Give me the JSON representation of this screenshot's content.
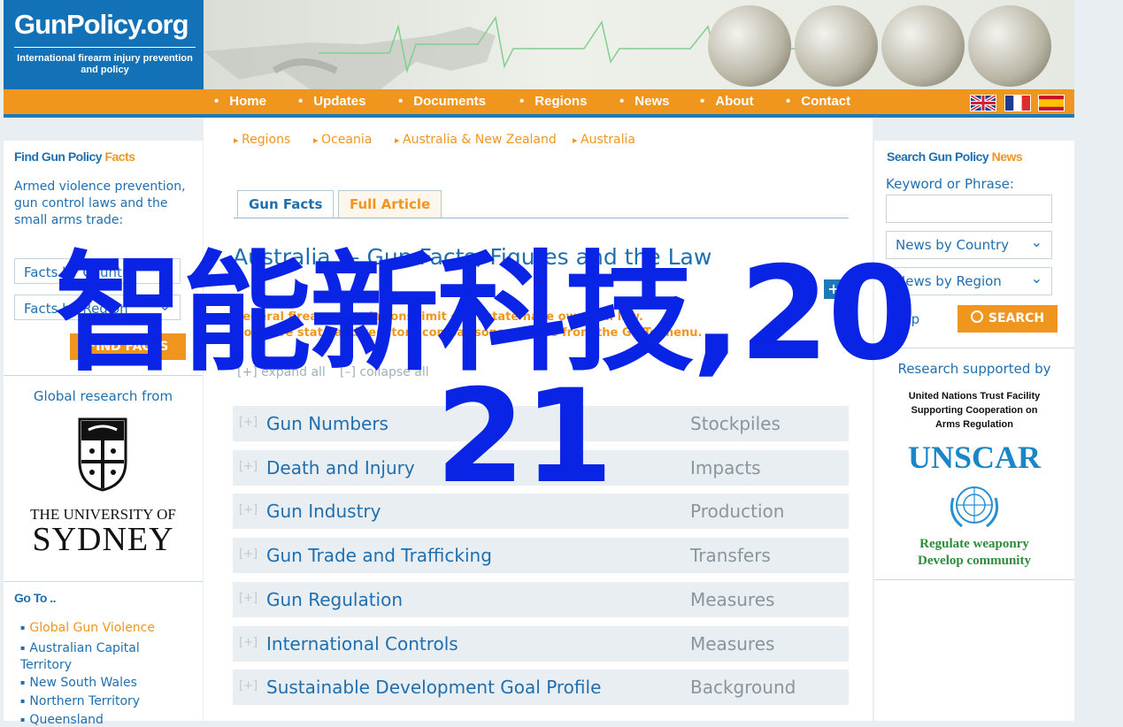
{
  "header": {
    "logo": "GunPolicy.org",
    "tagline": "International firearm injury prevention and policy"
  },
  "nav": {
    "items": [
      "Home",
      "Updates",
      "Documents",
      "Regions",
      "News",
      "About",
      "Contact"
    ]
  },
  "left": {
    "find_title_a": "Find Gun Policy ",
    "find_title_b": "Facts",
    "find_desc": "Armed violence prevention, gun control laws and the small arms trade:",
    "facts_select": "Facts by Country",
    "facts_region": "Facts by Region",
    "find_button": "FIND FACTS",
    "global_research": "Global research from",
    "univ_line1": "THE UNIVERSITY OF",
    "univ_line2": "SYDNEY",
    "goto_title": "Go To ..",
    "goto_items": [
      "Global Gun Violence",
      "Australian Capital Territory",
      "New South Wales",
      "Northern Territory",
      "Queensland"
    ]
  },
  "breadcrumb": [
    "Regions",
    "Oceania",
    "Australia & New Zealand",
    "Australia"
  ],
  "tabs": {
    "gun_facts": "Gun Facts",
    "full_article": "Full Article"
  },
  "main": {
    "title": "Australia — Gun Facts, Figures and the Law",
    "intro": "Federal firearm regulations limit each state have own gun law. Compare state and territory comparisons. choose from the Go To menu.",
    "expand": "expand all",
    "collapse": "collapse all",
    "expand_symbol": "[+]",
    "collapse_symbol": "[–]",
    "rows": [
      {
        "name": "Gun Numbers",
        "cat": "Stockpiles"
      },
      {
        "name": "Death and Injury",
        "cat": "Impacts"
      },
      {
        "name": "Gun Industry",
        "cat": "Production"
      },
      {
        "name": "Gun Trade and Trafficking",
        "cat": "Transfers"
      },
      {
        "name": "Gun Regulation",
        "cat": "Measures"
      },
      {
        "name": "International Controls",
        "cat": "Measures"
      },
      {
        "name": "Sustainable Development Goal Profile",
        "cat": "Background"
      }
    ]
  },
  "right": {
    "search_title_a": "Search Gun Policy ",
    "search_title_b": "News",
    "keyword_label": "Keyword or Phrase:",
    "news_country": "News by Country",
    "news_region": "News by Region",
    "help": "Help",
    "search_btn": "SEARCH",
    "research_supported": "Research supported by",
    "un_text": "United Nations Trust Facility Supporting Cooperation on Arms Regulation",
    "unscar": "UNSCAR",
    "slogan1": "Regulate weaponry",
    "slogan2": "Develop community"
  },
  "overlay": {
    "line1": "智能新科技,20",
    "line2": "21"
  },
  "colors": {
    "brand_blue": "#1271b7",
    "nav_orange": "#f0961f",
    "overlay_blue": "#0a24e6"
  }
}
